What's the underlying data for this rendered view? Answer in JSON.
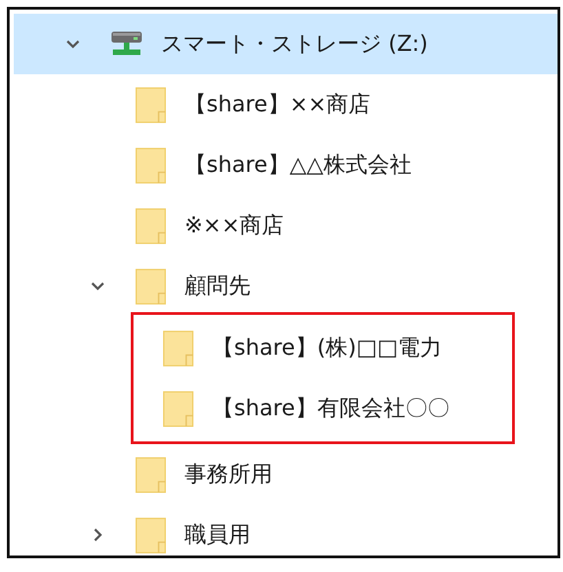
{
  "tree": [
    {
      "kind": "drive",
      "label": "スマート・ストレージ (Z:)",
      "selected": true,
      "expanded": true,
      "children": [
        {
          "kind": "folder",
          "label": "【share】××商店",
          "selected": false
        },
        {
          "kind": "folder",
          "label": "【share】△△株式会社",
          "selected": false
        },
        {
          "kind": "folder",
          "label": "※××商店",
          "selected": false
        },
        {
          "kind": "folder",
          "label": "顧問先",
          "selected": false,
          "expanded": true,
          "children_outlined": true,
          "children": [
            {
              "kind": "folder",
              "label": "【share】(株)□□電力",
              "selected": false
            },
            {
              "kind": "folder",
              "label": "【share】有限会社〇〇",
              "selected": false
            }
          ]
        },
        {
          "kind": "folder",
          "label": "事務所用",
          "selected": false
        },
        {
          "kind": "folder",
          "label": "職員用",
          "selected": false,
          "expanded": false
        }
      ]
    }
  ]
}
